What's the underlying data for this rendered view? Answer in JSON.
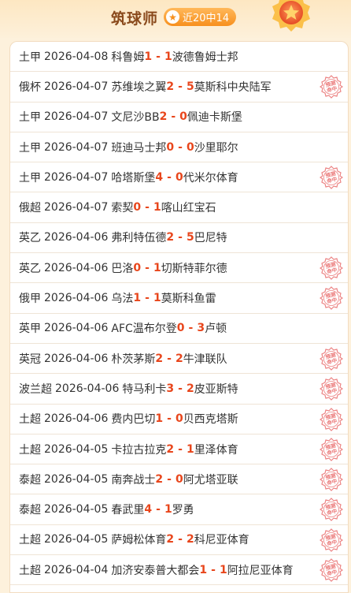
{
  "header": {
    "title": "筑球师",
    "badge": "近20中14",
    "star_glyph": "★"
  },
  "stamp_text": [
    "预测",
    "命中"
  ],
  "colors": {
    "score": "#e8461c",
    "title": "#8a4a1c",
    "badge": "#f7901e",
    "stamp": "#e65a5a"
  },
  "matches": [
    {
      "league": "土甲",
      "date": "2026-04-08",
      "home": "科鲁姆",
      "hs": "1",
      "as": "1",
      "away": "波德鲁姆士邦",
      "hit": false
    },
    {
      "league": "俄杯",
      "date": "2026-04-07",
      "home": "苏维埃之翼",
      "hs": "2",
      "as": "5",
      "away": "莫斯科中央陆军",
      "hit": true
    },
    {
      "league": "土甲",
      "date": "2026-04-07",
      "home": "文尼沙BB",
      "hs": "2",
      "as": "0",
      "away": "佩迪卡斯堡",
      "hit": false
    },
    {
      "league": "土甲",
      "date": "2026-04-07",
      "home": "班迪马士邦",
      "hs": "0",
      "as": "0",
      "away": "沙里耶尔",
      "hit": false
    },
    {
      "league": "土甲",
      "date": "2026-04-07",
      "home": "哈塔斯堡",
      "hs": "4",
      "as": "0",
      "away": "代米尔体育",
      "hit": true
    },
    {
      "league": "俄超",
      "date": "2026-04-07",
      "home": "索契",
      "hs": "0",
      "as": "1",
      "away": "喀山红宝石",
      "hit": false
    },
    {
      "league": "英乙",
      "date": "2026-04-06",
      "home": "弗利特伍德",
      "hs": "2",
      "as": "5",
      "away": "巴尼特",
      "hit": false
    },
    {
      "league": "英乙",
      "date": "2026-04-06",
      "home": "巴洛",
      "hs": "0",
      "as": "1",
      "away": "切斯特菲尔德",
      "hit": true
    },
    {
      "league": "俄甲",
      "date": "2026-04-06",
      "home": "乌法",
      "hs": "1",
      "as": "1",
      "away": "莫斯科鱼雷",
      "hit": true
    },
    {
      "league": "英甲",
      "date": "2026-04-06",
      "home": "AFC温布尔登",
      "hs": "0",
      "as": "3",
      "away": "卢顿",
      "hit": false
    },
    {
      "league": "英冠",
      "date": "2026-04-06",
      "home": "朴茨茅斯",
      "hs": "2",
      "as": "2",
      "away": "牛津联队",
      "hit": true
    },
    {
      "league": "波兰超",
      "date": "2026-04-06",
      "home": "特马利卡",
      "hs": "3",
      "as": "2",
      "away": "皮亚斯特",
      "hit": true
    },
    {
      "league": "土超",
      "date": "2026-04-06",
      "home": "费内巴切",
      "hs": "1",
      "as": "0",
      "away": "贝西克塔斯",
      "hit": true
    },
    {
      "league": "土超",
      "date": "2026-04-05",
      "home": "卡拉古拉克",
      "hs": "2",
      "as": "1",
      "away": "里泽体育",
      "hit": true
    },
    {
      "league": "泰超",
      "date": "2026-04-05",
      "home": "南奔战士",
      "hs": "2",
      "as": "0",
      "away": "阿尤塔亚联",
      "hit": true
    },
    {
      "league": "泰超",
      "date": "2026-04-05",
      "home": "春武里",
      "hs": "4",
      "as": "1",
      "away": "罗勇",
      "hit": true
    },
    {
      "league": "土超",
      "date": "2026-04-05",
      "home": "萨姆松体育",
      "hs": "2",
      "as": "2",
      "away": "科尼亚体育",
      "hit": true
    },
    {
      "league": "土超",
      "date": "2026-04-04",
      "home": "加济安泰普大都会",
      "hs": "1",
      "as": "1",
      "away": "阿拉尼亚体育",
      "hit": true
    }
  ]
}
